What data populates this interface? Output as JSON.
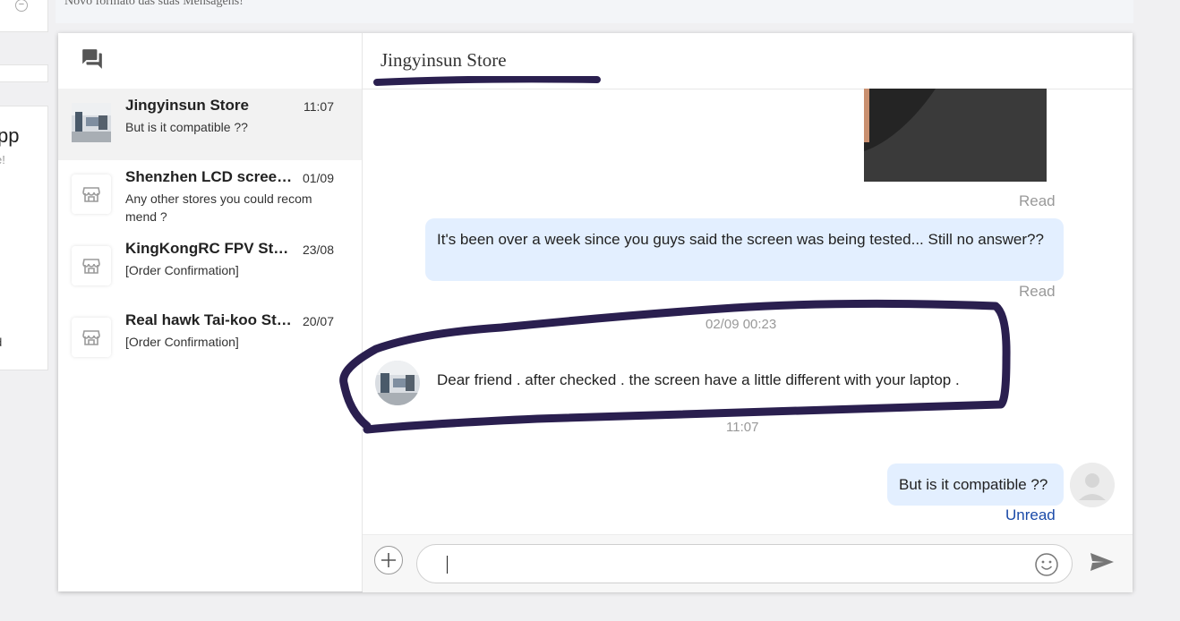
{
  "background_hint": {
    "banner_text": "Novo formato das suas Mensagens!",
    "card_text_a": "pp",
    "card_text_b": "e!",
    "card_text_c": "d"
  },
  "sidebar": {
    "conversations": [
      {
        "name": "Jingyinsun Store",
        "time": "11:07",
        "preview": "But is it compatible ??",
        "active": true,
        "avatar": "store-photo"
      },
      {
        "name": "Shenzhen LCD screen Store",
        "time": "01/09",
        "preview": "Any other stores you could recom mend ?",
        "active": false,
        "avatar": "store-icon"
      },
      {
        "name": "KingKongRC FPV Store",
        "time": "23/08",
        "preview": "[Order Confirmation]",
        "active": false,
        "avatar": "store-icon"
      },
      {
        "name": "Real hawk Tai-koo Store",
        "time": "20/07",
        "preview": "[Order Confirmation]",
        "active": false,
        "avatar": "store-icon"
      }
    ]
  },
  "chat": {
    "title": "Jingyinsun Store",
    "messages": {
      "read_1": "Read",
      "outgoing_1": "It's been over a week since you guys said the screen was being tested... Still no answer??",
      "read_2": "Read",
      "timestamp_1": "02/09 00:23",
      "incoming_1": "Dear friend . after checked . the screen have a little different with your laptop .",
      "timestamp_2": "11:07",
      "outgoing_2": "But is it compatible ??",
      "status_2": "Unread"
    },
    "input_value": ""
  },
  "colors": {
    "bubble": "#e3efff",
    "unread": "#1a4aa8",
    "annotation": "#2a1f4f"
  }
}
